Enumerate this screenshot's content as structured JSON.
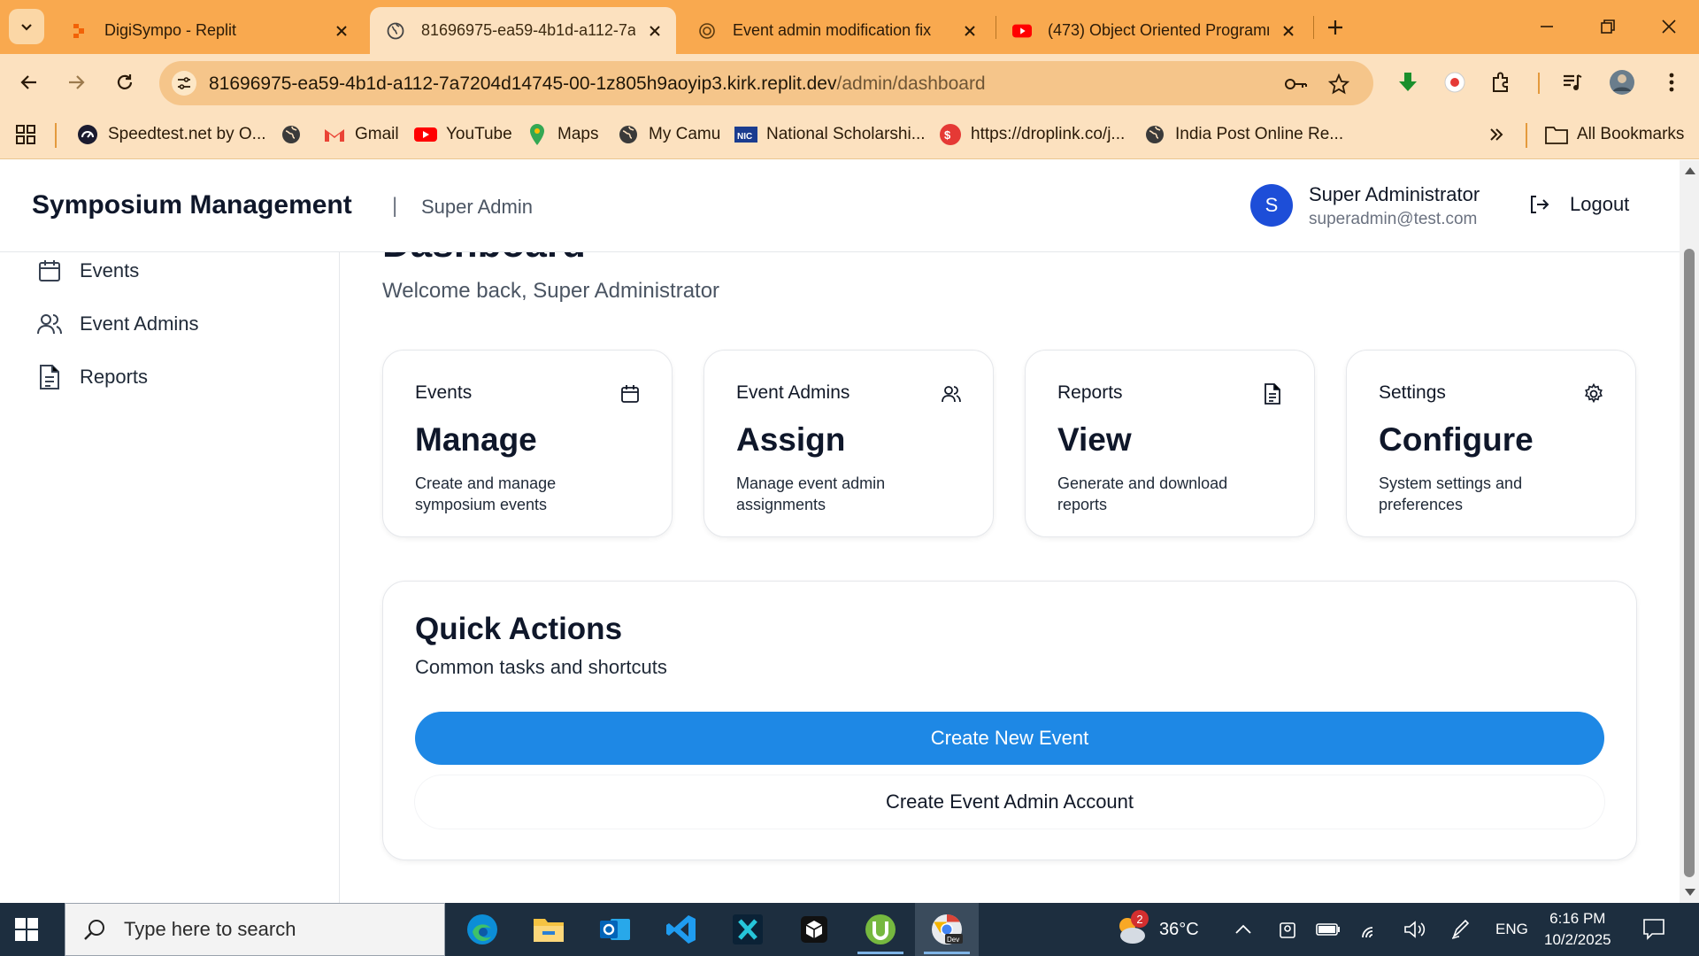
{
  "browser": {
    "tabs": [
      {
        "title": "DigiSympo - Replit",
        "active": false
      },
      {
        "title": "81696975-ea59-4b1d-a112-7a7",
        "active": true
      },
      {
        "title": "Event admin modification fix",
        "active": false
      },
      {
        "title": "(473) Object Oriented Programm",
        "active": false
      }
    ],
    "url_host": "81696975-ea59-4b1d-a112-7a7204d14745-00-1z805h9aoyip3.kirk.replit.dev",
    "url_path": "/admin/dashboard",
    "bookmarks": [
      {
        "label": "Speedtest.net by O...",
        "icon": "speedtest-icon"
      },
      {
        "label": "",
        "icon": "globe-icon"
      },
      {
        "label": "Gmail",
        "icon": "gmail-icon"
      },
      {
        "label": "YouTube",
        "icon": "youtube-icon"
      },
      {
        "label": "Maps",
        "icon": "maps-icon"
      },
      {
        "label": "My Camu",
        "icon": "globe-icon"
      },
      {
        "label": "National Scholarshi...",
        "icon": "nic-icon"
      },
      {
        "label": "https://droplink.co/j...",
        "icon": "droplink-icon"
      },
      {
        "label": "India Post Online Re...",
        "icon": "globe-icon"
      }
    ],
    "all_bookmarks": "All Bookmarks",
    "accent": "#f9a94f"
  },
  "header": {
    "brand": "Symposium Management",
    "divider": "|",
    "role": "Super Admin",
    "avatar_letter": "S",
    "user_name": "Super Administrator",
    "user_email": "superadmin@test.com",
    "logout": "Logout"
  },
  "sidebar": {
    "items": [
      {
        "label": "Events",
        "icon": "calendar-icon"
      },
      {
        "label": "Event Admins",
        "icon": "users-icon"
      },
      {
        "label": "Reports",
        "icon": "file-text-icon"
      }
    ]
  },
  "main": {
    "title": "Dashboard",
    "welcome": "Welcome back, Super Administrator",
    "cards": [
      {
        "label": "Events",
        "value": "Manage",
        "desc": "Create and manage symposium events",
        "icon": "calendar-icon"
      },
      {
        "label": "Event Admins",
        "value": "Assign",
        "desc": "Manage event admin assignments",
        "icon": "users-icon"
      },
      {
        "label": "Reports",
        "value": "View",
        "desc": "Generate and download reports",
        "icon": "file-text-icon"
      },
      {
        "label": "Settings",
        "value": "Configure",
        "desc": "System settings and preferences",
        "icon": "gear-icon"
      }
    ],
    "quick_actions": {
      "title": "Quick Actions",
      "subtitle": "Common tasks and shortcuts",
      "primary": "Create New Event",
      "secondary": "Create Event Admin Account"
    },
    "primary_color": "#1e88e5"
  },
  "taskbar": {
    "search_placeholder": "Type here to search",
    "weather_temp": "36°C",
    "weather_badge": "2",
    "language": "ENG",
    "time": "6:16 PM",
    "date": "10/2/2025"
  }
}
